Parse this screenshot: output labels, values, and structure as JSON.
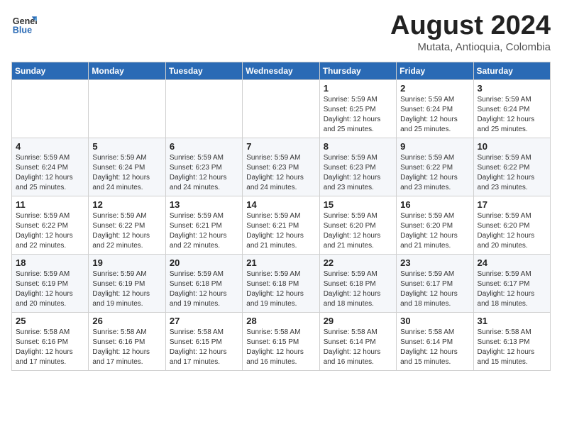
{
  "header": {
    "logo_line1": "General",
    "logo_line2": "Blue",
    "month_year": "August 2024",
    "location": "Mutata, Antioquia, Colombia"
  },
  "weekdays": [
    "Sunday",
    "Monday",
    "Tuesday",
    "Wednesday",
    "Thursday",
    "Friday",
    "Saturday"
  ],
  "weeks": [
    [
      {
        "day": "",
        "info": ""
      },
      {
        "day": "",
        "info": ""
      },
      {
        "day": "",
        "info": ""
      },
      {
        "day": "",
        "info": ""
      },
      {
        "day": "1",
        "info": "Sunrise: 5:59 AM\nSunset: 6:25 PM\nDaylight: 12 hours\nand 25 minutes."
      },
      {
        "day": "2",
        "info": "Sunrise: 5:59 AM\nSunset: 6:24 PM\nDaylight: 12 hours\nand 25 minutes."
      },
      {
        "day": "3",
        "info": "Sunrise: 5:59 AM\nSunset: 6:24 PM\nDaylight: 12 hours\nand 25 minutes."
      }
    ],
    [
      {
        "day": "4",
        "info": "Sunrise: 5:59 AM\nSunset: 6:24 PM\nDaylight: 12 hours\nand 25 minutes."
      },
      {
        "day": "5",
        "info": "Sunrise: 5:59 AM\nSunset: 6:24 PM\nDaylight: 12 hours\nand 24 minutes."
      },
      {
        "day": "6",
        "info": "Sunrise: 5:59 AM\nSunset: 6:23 PM\nDaylight: 12 hours\nand 24 minutes."
      },
      {
        "day": "7",
        "info": "Sunrise: 5:59 AM\nSunset: 6:23 PM\nDaylight: 12 hours\nand 24 minutes."
      },
      {
        "day": "8",
        "info": "Sunrise: 5:59 AM\nSunset: 6:23 PM\nDaylight: 12 hours\nand 23 minutes."
      },
      {
        "day": "9",
        "info": "Sunrise: 5:59 AM\nSunset: 6:22 PM\nDaylight: 12 hours\nand 23 minutes."
      },
      {
        "day": "10",
        "info": "Sunrise: 5:59 AM\nSunset: 6:22 PM\nDaylight: 12 hours\nand 23 minutes."
      }
    ],
    [
      {
        "day": "11",
        "info": "Sunrise: 5:59 AM\nSunset: 6:22 PM\nDaylight: 12 hours\nand 22 minutes."
      },
      {
        "day": "12",
        "info": "Sunrise: 5:59 AM\nSunset: 6:22 PM\nDaylight: 12 hours\nand 22 minutes."
      },
      {
        "day": "13",
        "info": "Sunrise: 5:59 AM\nSunset: 6:21 PM\nDaylight: 12 hours\nand 22 minutes."
      },
      {
        "day": "14",
        "info": "Sunrise: 5:59 AM\nSunset: 6:21 PM\nDaylight: 12 hours\nand 21 minutes."
      },
      {
        "day": "15",
        "info": "Sunrise: 5:59 AM\nSunset: 6:20 PM\nDaylight: 12 hours\nand 21 minutes."
      },
      {
        "day": "16",
        "info": "Sunrise: 5:59 AM\nSunset: 6:20 PM\nDaylight: 12 hours\nand 21 minutes."
      },
      {
        "day": "17",
        "info": "Sunrise: 5:59 AM\nSunset: 6:20 PM\nDaylight: 12 hours\nand 20 minutes."
      }
    ],
    [
      {
        "day": "18",
        "info": "Sunrise: 5:59 AM\nSunset: 6:19 PM\nDaylight: 12 hours\nand 20 minutes."
      },
      {
        "day": "19",
        "info": "Sunrise: 5:59 AM\nSunset: 6:19 PM\nDaylight: 12 hours\nand 19 minutes."
      },
      {
        "day": "20",
        "info": "Sunrise: 5:59 AM\nSunset: 6:18 PM\nDaylight: 12 hours\nand 19 minutes."
      },
      {
        "day": "21",
        "info": "Sunrise: 5:59 AM\nSunset: 6:18 PM\nDaylight: 12 hours\nand 19 minutes."
      },
      {
        "day": "22",
        "info": "Sunrise: 5:59 AM\nSunset: 6:18 PM\nDaylight: 12 hours\nand 18 minutes."
      },
      {
        "day": "23",
        "info": "Sunrise: 5:59 AM\nSunset: 6:17 PM\nDaylight: 12 hours\nand 18 minutes."
      },
      {
        "day": "24",
        "info": "Sunrise: 5:59 AM\nSunset: 6:17 PM\nDaylight: 12 hours\nand 18 minutes."
      }
    ],
    [
      {
        "day": "25",
        "info": "Sunrise: 5:58 AM\nSunset: 6:16 PM\nDaylight: 12 hours\nand 17 minutes."
      },
      {
        "day": "26",
        "info": "Sunrise: 5:58 AM\nSunset: 6:16 PM\nDaylight: 12 hours\nand 17 minutes."
      },
      {
        "day": "27",
        "info": "Sunrise: 5:58 AM\nSunset: 6:15 PM\nDaylight: 12 hours\nand 17 minutes."
      },
      {
        "day": "28",
        "info": "Sunrise: 5:58 AM\nSunset: 6:15 PM\nDaylight: 12 hours\nand 16 minutes."
      },
      {
        "day": "29",
        "info": "Sunrise: 5:58 AM\nSunset: 6:14 PM\nDaylight: 12 hours\nand 16 minutes."
      },
      {
        "day": "30",
        "info": "Sunrise: 5:58 AM\nSunset: 6:14 PM\nDaylight: 12 hours\nand 15 minutes."
      },
      {
        "day": "31",
        "info": "Sunrise: 5:58 AM\nSunset: 6:13 PM\nDaylight: 12 hours\nand 15 minutes."
      }
    ]
  ]
}
